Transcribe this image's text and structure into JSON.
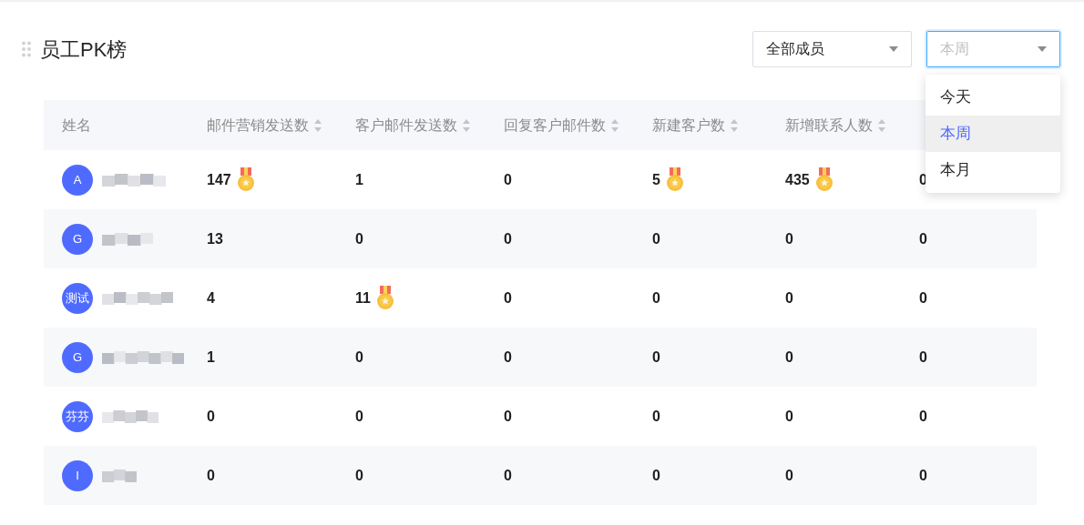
{
  "title": "员工PK榜",
  "filters": [
    {
      "value": "全部成员",
      "focused": false
    },
    {
      "placeholder": "本周",
      "focused": true
    }
  ],
  "dropdown": {
    "options": [
      {
        "label": "今天",
        "selected": false
      },
      {
        "label": "本周",
        "selected": true
      },
      {
        "label": "本月",
        "selected": false
      }
    ]
  },
  "table": {
    "columns": [
      {
        "label": "姓名",
        "sortable": false
      },
      {
        "label": "邮件营销发送数",
        "sortable": true
      },
      {
        "label": "客户邮件发送数",
        "sortable": true
      },
      {
        "label": "回复客户邮件数",
        "sortable": true
      },
      {
        "label": "新建客户数",
        "sortable": true
      },
      {
        "label": "新增联系人数",
        "sortable": true
      }
    ],
    "rows": [
      {
        "cells": [
          {
            "kind": "person",
            "avatar": "A"
          },
          {
            "kind": "count",
            "value": "147",
            "medal": true
          },
          {
            "kind": "count",
            "value": "1",
            "medal": false
          },
          {
            "kind": "count",
            "value": "0",
            "medal": false
          },
          {
            "kind": "count",
            "value": "5",
            "medal": true
          },
          {
            "kind": "count",
            "value": "435",
            "medal": true
          },
          {
            "kind": "count",
            "value": "0",
            "medal": false
          }
        ]
      },
      {
        "cells": [
          {
            "kind": "person",
            "avatar": "G"
          },
          {
            "kind": "count",
            "value": "13",
            "medal": false
          },
          {
            "kind": "count",
            "value": "0",
            "medal": false
          },
          {
            "kind": "count",
            "value": "0",
            "medal": false
          },
          {
            "kind": "count",
            "value": "0",
            "medal": false
          },
          {
            "kind": "count",
            "value": "0",
            "medal": false
          },
          {
            "kind": "count",
            "value": "0",
            "medal": false
          }
        ]
      },
      {
        "cells": [
          {
            "kind": "person",
            "avatar": "测试"
          },
          {
            "kind": "count",
            "value": "4",
            "medal": false
          },
          {
            "kind": "count",
            "value": "11",
            "medal": true
          },
          {
            "kind": "count",
            "value": "0",
            "medal": false
          },
          {
            "kind": "count",
            "value": "0",
            "medal": false
          },
          {
            "kind": "count",
            "value": "0",
            "medal": false
          },
          {
            "kind": "count",
            "value": "0",
            "medal": false
          }
        ]
      },
      {
        "cells": [
          {
            "kind": "person",
            "avatar": "G"
          },
          {
            "kind": "count",
            "value": "1",
            "medal": false
          },
          {
            "kind": "count",
            "value": "0",
            "medal": false
          },
          {
            "kind": "count",
            "value": "0",
            "medal": false
          },
          {
            "kind": "count",
            "value": "0",
            "medal": false
          },
          {
            "kind": "count",
            "value": "0",
            "medal": false
          },
          {
            "kind": "count",
            "value": "0",
            "medal": false
          }
        ]
      },
      {
        "cells": [
          {
            "kind": "person",
            "avatar": "芬芬"
          },
          {
            "kind": "count",
            "value": "0",
            "medal": false
          },
          {
            "kind": "count",
            "value": "0",
            "medal": false
          },
          {
            "kind": "count",
            "value": "0",
            "medal": false
          },
          {
            "kind": "count",
            "value": "0",
            "medal": false
          },
          {
            "kind": "count",
            "value": "0",
            "medal": false
          },
          {
            "kind": "count",
            "value": "0",
            "medal": false
          }
        ]
      },
      {
        "cells": [
          {
            "kind": "person",
            "avatar": "I"
          },
          {
            "kind": "count",
            "value": "0",
            "medal": false
          },
          {
            "kind": "count",
            "value": "0",
            "medal": false
          },
          {
            "kind": "count",
            "value": "0",
            "medal": false
          },
          {
            "kind": "count",
            "value": "0",
            "medal": false
          },
          {
            "kind": "count",
            "value": "0",
            "medal": false
          },
          {
            "kind": "count",
            "value": "0",
            "medal": false
          }
        ]
      }
    ]
  }
}
